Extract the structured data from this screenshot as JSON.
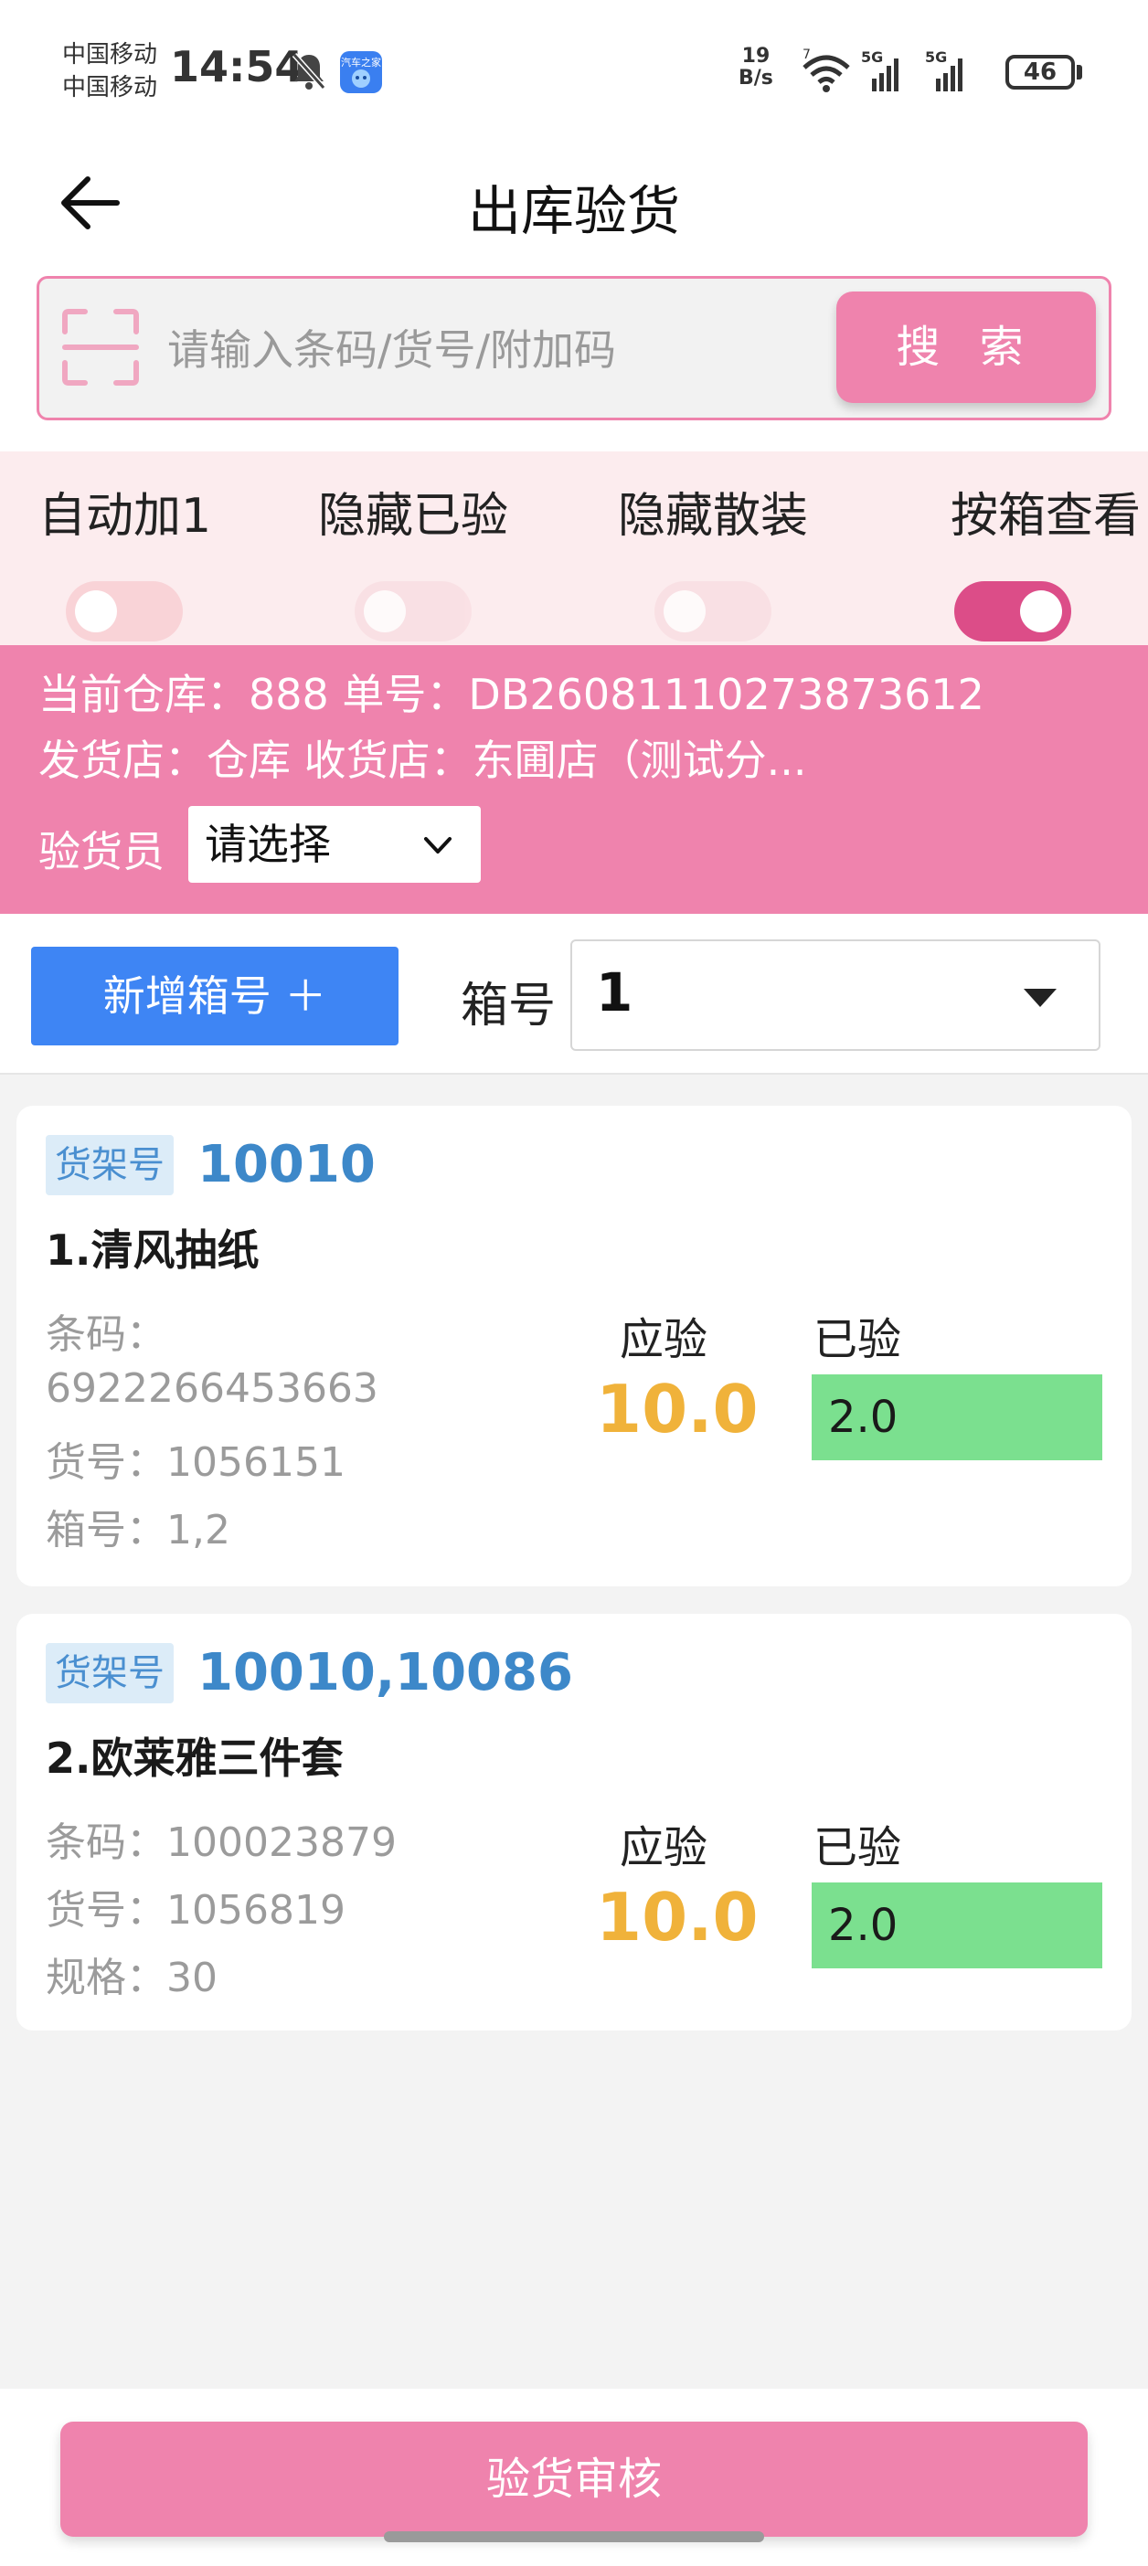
{
  "status_bar": {
    "carrier_1": "中国移动",
    "carrier_2": "中国移动",
    "time": "14:54",
    "speed_value": "19",
    "speed_unit": "B/s",
    "battery": "46",
    "app_icon_text": "汽车之家"
  },
  "header": {
    "title": "出库验货"
  },
  "search": {
    "placeholder": "请输入条码/货号/附加码",
    "button_label": "搜 索"
  },
  "toggles": [
    {
      "label": "自动加1",
      "on": false
    },
    {
      "label": "隐藏已验",
      "on": false
    },
    {
      "label": "隐藏散装",
      "on": false
    },
    {
      "label": "按箱查看",
      "on": true
    }
  ],
  "info": {
    "line1": "当前仓库：888  单号：DB26081110273873612",
    "line2": "发货店：仓库  收货店：东圃店（测试分...",
    "inspector_label": "验货员",
    "inspector_value": "请选择"
  },
  "box": {
    "add_button_label": "新增箱号 ＋",
    "box_label": "箱号",
    "box_value": "1"
  },
  "items": [
    {
      "shelf_tag": "货架号",
      "shelf_no": "10010",
      "name": "1.清风抽纸",
      "meta": [
        "条码：",
        "6922266453663",
        "货号：1056151",
        "箱号：1,2"
      ],
      "expected_label": "应验",
      "expected_value": "10.0",
      "checked_label": "已验",
      "checked_value": "2.0"
    },
    {
      "shelf_tag": "货架号",
      "shelf_no": "10010,10086",
      "name": "2.欧莱雅三件套",
      "meta": [
        "条码：100023879",
        "货号：1056819",
        "规格：30"
      ],
      "expected_label": "应验",
      "expected_value": "10.0",
      "checked_label": "已验",
      "checked_value": "2.0"
    }
  ],
  "footer": {
    "audit_button_label": "验货审核"
  },
  "colors": {
    "accent_pink": "#ef83ad",
    "switch_on": "#dc4d88",
    "button_blue": "#3e85f4",
    "expected_orange": "#f0b23a",
    "checked_green": "#7be08f",
    "shelf_blue": "#3d88c9"
  }
}
